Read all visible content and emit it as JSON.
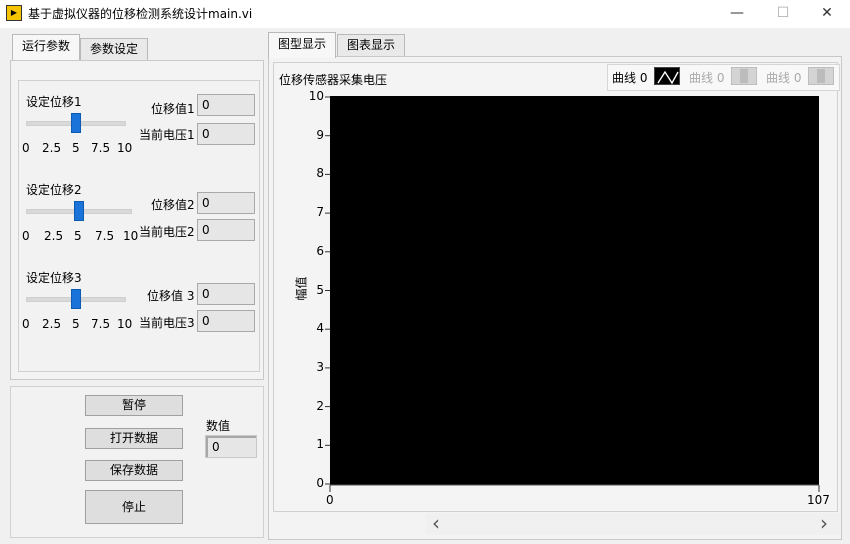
{
  "window": {
    "title": "基于虚拟仪器的位移检测系统设计main.vi",
    "icon_glyph": "▶",
    "minimize_glyph": "—",
    "maximize_glyph": "☐",
    "close_glyph": "✕"
  },
  "left_tabs": {
    "params": "运行参数",
    "settings": "参数设定"
  },
  "right_tabs": {
    "graph": "图型显示",
    "chart": "图表显示"
  },
  "sliders": [
    {
      "label": "设定位移1",
      "ticks": [
        "0",
        "2.5",
        "5",
        "7.5",
        "10"
      ],
      "value": 5,
      "disp_label": "位移值1",
      "disp_value": "0",
      "volt_label": "当前电压1",
      "volt_value": "0"
    },
    {
      "label": "设定位移2",
      "ticks": [
        "0",
        "2.5",
        "5",
        "7.5",
        "10"
      ],
      "value": 5,
      "disp_label": "位移值2",
      "disp_value": "0",
      "volt_label": "当前电压2",
      "volt_value": "0"
    },
    {
      "label": "设定位移3",
      "ticks": [
        "0",
        "2.5",
        "5",
        "7.5",
        "10"
      ],
      "value": 5,
      "disp_label": "位移值 3",
      "disp_value": "0",
      "volt_label": "当前电压3",
      "volt_value": "0"
    }
  ],
  "buttons": {
    "pause": "暂停",
    "open": "打开数据",
    "save": "保存数据",
    "stop": "停止"
  },
  "numeric": {
    "label": "数值",
    "value": "0"
  },
  "graph": {
    "title": "位移传感器采集电压",
    "ylabel": "幅值",
    "y_ticks": [
      "10",
      "9",
      "8",
      "7",
      "6",
      "5",
      "4",
      "3",
      "2",
      "1",
      "0"
    ],
    "x_min": "0",
    "x_max": "107",
    "legend": [
      {
        "label": "曲线 0",
        "active": true
      },
      {
        "label": "曲线 0",
        "active": false
      },
      {
        "label": "曲线 0",
        "active": false
      }
    ],
    "scroll_left": "‹",
    "scroll_right": "›"
  }
}
